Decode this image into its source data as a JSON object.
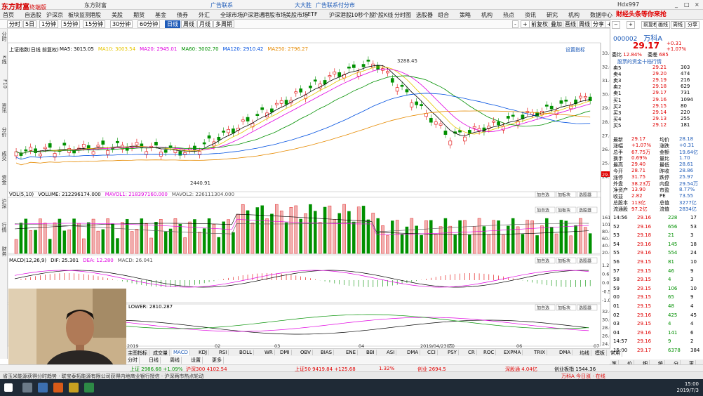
{
  "app": {
    "logo": "东方财富",
    "logo_sub": "终端版",
    "title_menus": [
      "东方财富",
      "广告联系",
      "大大胜",
      "广告联系付分市",
      "Hdx997"
    ],
    "window_controls": [
      "_",
      "□",
      "×"
    ]
  },
  "menu": [
    "首页",
    "自选股",
    "沪深京",
    "板块监测",
    "港股",
    "美股",
    "期货",
    "基金",
    "债券",
    "外汇",
    "全球市场",
    "沪深港通",
    "港股市场",
    "美股市场",
    "ETF",
    "沪深港股",
    "10秒个股",
    "个股K线",
    "分时图",
    "选股器",
    "组合",
    "策略",
    "机构",
    "热点",
    "资讯",
    "研究",
    "机构",
    "数据中心"
  ],
  "ad_text": "财经头条等你来抢",
  "toolbar": {
    "left": [
      "分时",
      "5日",
      "1分钟",
      "5分钟",
      "15分钟",
      "30分钟",
      "60分钟",
      "日线",
      "周线",
      "月线",
      "多周期"
    ],
    "active": "日线",
    "right": [
      "-",
      "+",
      "前复权",
      "叠加",
      "画线",
      "周线",
      "分享",
      "+",
      "分享",
      "叠加",
      "画线",
      "除"
    ]
  },
  "left_tabs": [
    "分时",
    "K线",
    "F10",
    "资讯",
    "分价",
    "成交",
    "资金",
    "沪深",
    "行情",
    "财务"
  ],
  "chart_main": {
    "legend_title": "上证指数(日线 前复权)",
    "ma_legend": [
      {
        "label": "MA5: 3015.05",
        "color": "#000000"
      },
      {
        "label": "MA10: 3003.54",
        "color": "#e6c600"
      },
      {
        "label": "MA20: 2945.01",
        "color": "#e000e0"
      },
      {
        "label": "MA60: 3002.70",
        "color": "#009000"
      },
      {
        "label": "MA120: 2910.42",
        "color": "#0050e0"
      },
      {
        "label": "MA250: 2796.27",
        "color": "#e68a00"
      }
    ],
    "right_label": "设置指标",
    "high_label": "3288.45",
    "low_label": "2440.91",
    "axis": [
      "33.00",
      "32.00",
      "31.00",
      "30.00",
      "29.00",
      "28.00",
      "27.00",
      "26.00",
      "25.00",
      "24.90"
    ],
    "current_value": "29.17"
  },
  "chart_vol": {
    "legend": [
      {
        "label": "VOL(5,10)",
        "color": "#000000"
      },
      {
        "label": "VOLUME: 212296174.000",
        "color": "#000000"
      },
      {
        "label": "MAVOL1: 218397160.000",
        "color": "#e000e0"
      },
      {
        "label": "MAVOL2: 226111304.000",
        "color": "#555555"
      }
    ],
    "buttons": [
      "加自选",
      "加板块",
      "选股器"
    ],
    "axis": [
      "161.00",
      "101.00",
      "80.00",
      "60.00",
      "40.00",
      "20.00"
    ]
  },
  "chart_macd": {
    "legend": [
      {
        "label": "MACD(12,26,9)",
        "color": "#000000"
      },
      {
        "label": "DIF: 25.301",
        "color": "#000000"
      },
      {
        "label": "DEA: 12.280",
        "color": "#e000e0"
      },
      {
        "label": "MACD: 26.041",
        "color": "#555555"
      }
    ],
    "buttons": [
      "加自选",
      "加板块",
      "选股器"
    ],
    "axis": [
      "1.27",
      "0.67",
      "0.07",
      "-0.54",
      "-1.00"
    ]
  },
  "chart_kdj": {
    "legend": [
      {
        "label": "LOWER: 2810.287",
        "color": "#000000"
      }
    ],
    "buttons": [
      "加自选",
      "加板块",
      "选股器"
    ],
    "axis": [
      "32.00",
      "30.00",
      "28.00",
      "26.00",
      "24.90"
    ]
  },
  "x_axis": [
    "2019",
    "02",
    "03",
    "04",
    "2019/04/23(四)",
    "06",
    "07"
  ],
  "bottom_tabs": [
    "主图指标",
    "成交量",
    "MACD",
    "KDJ",
    "RSI",
    "BOLL",
    "WR",
    "DMI",
    "OBV",
    "BIAS",
    "ENE",
    "BBI",
    "ASI",
    "DMA",
    "CCI",
    "PSY",
    "CR",
    "ROC",
    "EXPMA",
    "TRIX",
    "DMA",
    "均线",
    "模板",
    "常用"
  ],
  "bottom_tabs_active": "MACD",
  "sub_tabs": [
    "分时",
    "日线",
    "周线",
    "设置",
    "更多"
  ],
  "right_panel": {
    "code": "000002",
    "name": "万科A",
    "price": "29.17",
    "change": "+0.31",
    "change_pct": "+1.07%",
    "rank_label": "委比",
    "rank_value": "12.84%",
    "webi_label": "委差",
    "webi_value": "685",
    "link": "股票的资金十档行情",
    "sells": [
      {
        "label": "卖5",
        "price": "29.21",
        "vol": "303"
      },
      {
        "label": "卖4",
        "price": "29.20",
        "vol": "474"
      },
      {
        "label": "卖3",
        "price": "29.19",
        "vol": "216"
      },
      {
        "label": "卖2",
        "price": "29.18",
        "vol": "629"
      },
      {
        "label": "卖1",
        "price": "29.17",
        "vol": "731"
      }
    ],
    "buys": [
      {
        "label": "买1",
        "price": "29.16",
        "vol": "1094"
      },
      {
        "label": "买2",
        "price": "29.15",
        "vol": "80"
      },
      {
        "label": "买3",
        "price": "29.14",
        "vol": "220"
      },
      {
        "label": "买4",
        "price": "29.13",
        "vol": "255"
      },
      {
        "label": "买5",
        "price": "29.12",
        "vol": "181"
      }
    ],
    "stats": [
      {
        "l1": "最新",
        "v1": "29.17",
        "l2": "均价",
        "v2": "28.18"
      },
      {
        "l1": "涨幅",
        "v1": "+1.07%",
        "l2": "涨跌",
        "v2": "+0.31"
      },
      {
        "l1": "总手",
        "v1": "67.75万",
        "l2": "金额",
        "v2": "19.64亿"
      },
      {
        "l1": "换手",
        "v1": "0.69%",
        "l2": "量比",
        "v2": "1.70"
      },
      {
        "l1": "最高",
        "v1": "29.40",
        "l2": "最低",
        "v2": "28.61"
      },
      {
        "l1": "今开",
        "v1": "28.71",
        "l2": "昨收",
        "v2": "28.86"
      },
      {
        "l1": "涨停",
        "v1": "31.75",
        "l2": "跌停",
        "v2": "25.97"
      },
      {
        "l1": "外盘",
        "v1": "38.23万",
        "l2": "内盘",
        "v2": "29.54万"
      },
      {
        "l1": "净资产",
        "v1": "13.90",
        "l2": "市盈",
        "v2": "8.77%"
      },
      {
        "l1": "收益",
        "v1": "2.82",
        "l2": "PE",
        "v2": "73.55"
      },
      {
        "l1": "总股本",
        "v1": "113亿",
        "l2": "总值",
        "v2": "3277亿"
      },
      {
        "l1": "流通股",
        "v1": "97.2亿",
        "l2": "流值",
        "v2": "2834亿"
      }
    ],
    "ticks": [
      {
        "time": "14:56",
        "price": "29.16",
        "vol": "228",
        "n": "17"
      },
      {
        "time": "52",
        "price": "29.16",
        "vol": "656",
        "n": "53"
      },
      {
        "time": "53",
        "price": "29.18",
        "vol": "21",
        "n": "3"
      },
      {
        "time": "54",
        "price": "29.16",
        "vol": "145",
        "n": "18"
      },
      {
        "time": "55",
        "price": "29.16",
        "vol": "554",
        "n": "24"
      },
      {
        "time": "56",
        "price": "29.15",
        "vol": "81",
        "n": "10"
      },
      {
        "time": "57",
        "price": "29.15",
        "vol": "46",
        "n": "9"
      },
      {
        "time": "58",
        "price": "29.15",
        "vol": "4",
        "n": "3"
      },
      {
        "time": "59",
        "price": "29.15",
        "vol": "106",
        "n": "10"
      },
      {
        "time": "00",
        "price": "29.15",
        "vol": "65",
        "n": "9"
      },
      {
        "time": "01",
        "price": "29.15",
        "vol": "48",
        "n": "4"
      },
      {
        "time": "02",
        "price": "29.16",
        "vol": "425",
        "n": "45"
      },
      {
        "time": "03",
        "price": "29.15",
        "vol": "4",
        "n": "4"
      },
      {
        "time": "04",
        "price": "29.16",
        "vol": "141",
        "n": "6"
      },
      {
        "time": "14:57",
        "price": "29.16",
        "vol": "9",
        "n": "2"
      },
      {
        "time": "15:00",
        "price": "29.17",
        "vol": "6378",
        "n": "384"
      }
    ],
    "bottom_tabs": [
      "笔",
      "价",
      "细",
      "统",
      "分",
      "更"
    ]
  },
  "index_bar": [
    {
      "name": "上证",
      "value": "2986.68",
      "change": "+1.09%",
      "color": "#009000"
    },
    {
      "name": "沪深300",
      "value": "4102.54",
      "change": "",
      "color": "#e00000"
    },
    {
      "name": "上证50",
      "value": "9419.84",
      "change": "+125.68",
      "color": "#e00000"
    },
    {
      "name": "",
      "value": "1.32%",
      "change": "",
      "color": "#e00000"
    },
    {
      "name": "创业",
      "value": "2694.5",
      "change": "",
      "color": "#e00000"
    },
    {
      "name": "深股通",
      "value": "4.04亿",
      "change": "",
      "color": "#e00000"
    },
    {
      "name": "创业板指",
      "value": "1544.36",
      "change": "",
      "color": "#000000"
    }
  ],
  "ticker_bar": "省玉米能源获得分时趋势 · 联宝泰拓能源有限公司获得内地商业银行授信 · 沪深两市热点轮动",
  "ticker_right": "万科A 今日涨 · 在线",
  "clock": {
    "time": "15:00",
    "date": "2019/7/3"
  }
}
